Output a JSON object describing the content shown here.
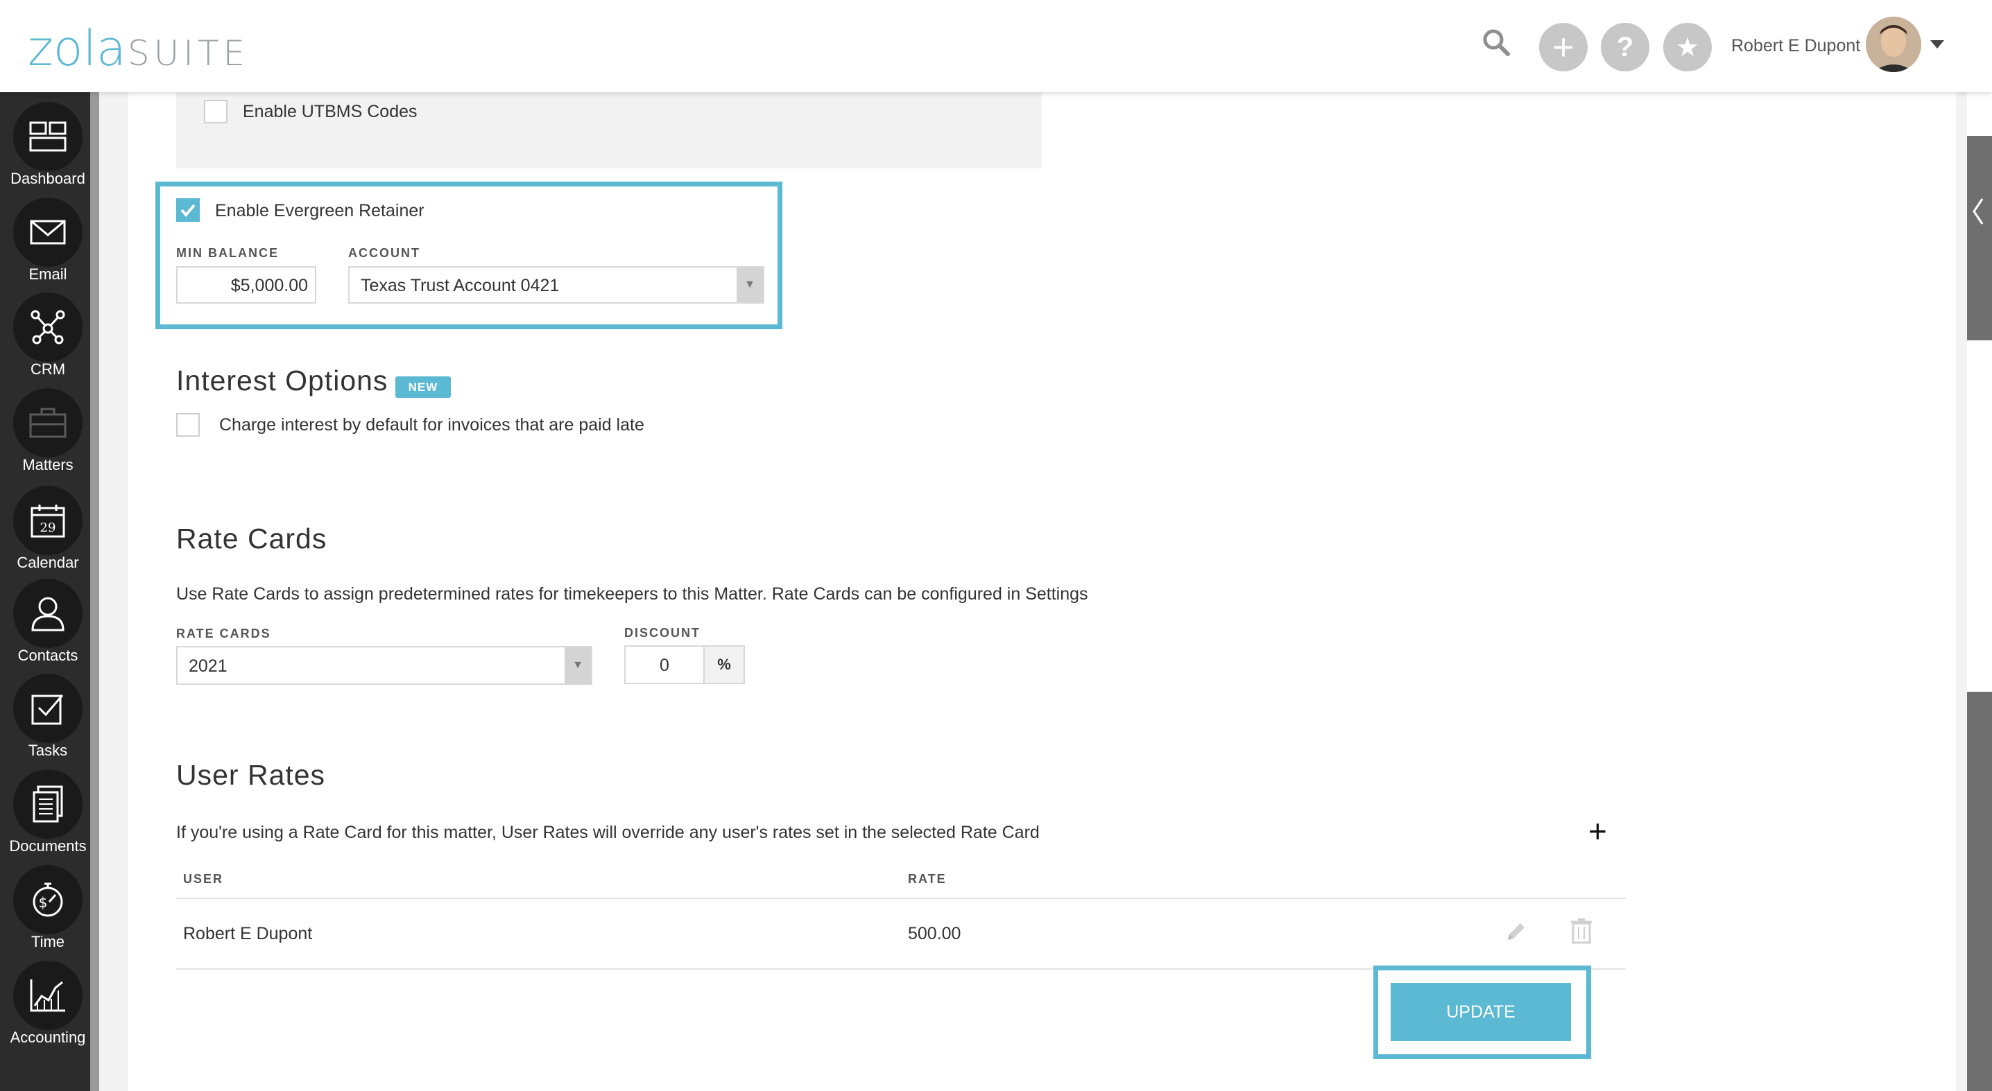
{
  "header": {
    "logo_primary": "zola",
    "logo_secondary": "SUITE",
    "user_name": "Robert E Dupont",
    "icons": [
      "search-icon",
      "add-icon",
      "help-icon",
      "star-icon",
      "chevron-down-icon"
    ]
  },
  "sidebar": {
    "items": [
      {
        "label": "Dashboard",
        "icon": "dashboard-icon"
      },
      {
        "label": "Email",
        "icon": "envelope-icon"
      },
      {
        "label": "CRM",
        "icon": "network-icon"
      },
      {
        "label": "Matters",
        "icon": "briefcase-icon"
      },
      {
        "label": "Calendar",
        "icon": "calendar-icon"
      },
      {
        "label": "Contacts",
        "icon": "person-icon"
      },
      {
        "label": "Tasks",
        "icon": "checkbox-icon"
      },
      {
        "label": "Documents",
        "icon": "document-icon"
      },
      {
        "label": "Time",
        "icon": "stopwatch-icon"
      },
      {
        "label": "Accounting",
        "icon": "chart-icon"
      }
    ],
    "calendar_day": "29"
  },
  "billing": {
    "utbms_label": "Enable UTBMS Codes",
    "utbms_checked": false,
    "evergreen_label": "Enable Evergreen Retainer",
    "evergreen_checked": true,
    "min_balance_label": "MIN BALANCE",
    "min_balance_value": "$5,000.00",
    "account_label": "ACCOUNT",
    "account_value": "Texas Trust Account 0421"
  },
  "interest": {
    "title": "Interest Options",
    "badge": "NEW",
    "charge_label": "Charge interest by default for invoices that are paid late",
    "charge_checked": false
  },
  "rate_cards": {
    "title": "Rate Cards",
    "description": "Use Rate Cards to assign predetermined rates for timekeepers to this Matter. Rate Cards can be configured in Settings",
    "rate_cards_label": "RATE CARDS",
    "rate_cards_value": "2021",
    "discount_label": "DISCOUNT",
    "discount_value": "0",
    "discount_unit": "%"
  },
  "user_rates": {
    "title": "User Rates",
    "description": "If you're using a Rate Card for this matter, User Rates will override any user's rates set in the selected Rate Card",
    "add_symbol": "+",
    "columns": [
      "USER",
      "RATE"
    ],
    "rows": [
      {
        "user": "Robert E Dupont",
        "rate": "500.00"
      }
    ]
  },
  "actions": {
    "update_label": "UPDATE"
  },
  "colors": {
    "accent": "#5bb9d3",
    "sidebar_bg": "#2c2c2c"
  }
}
